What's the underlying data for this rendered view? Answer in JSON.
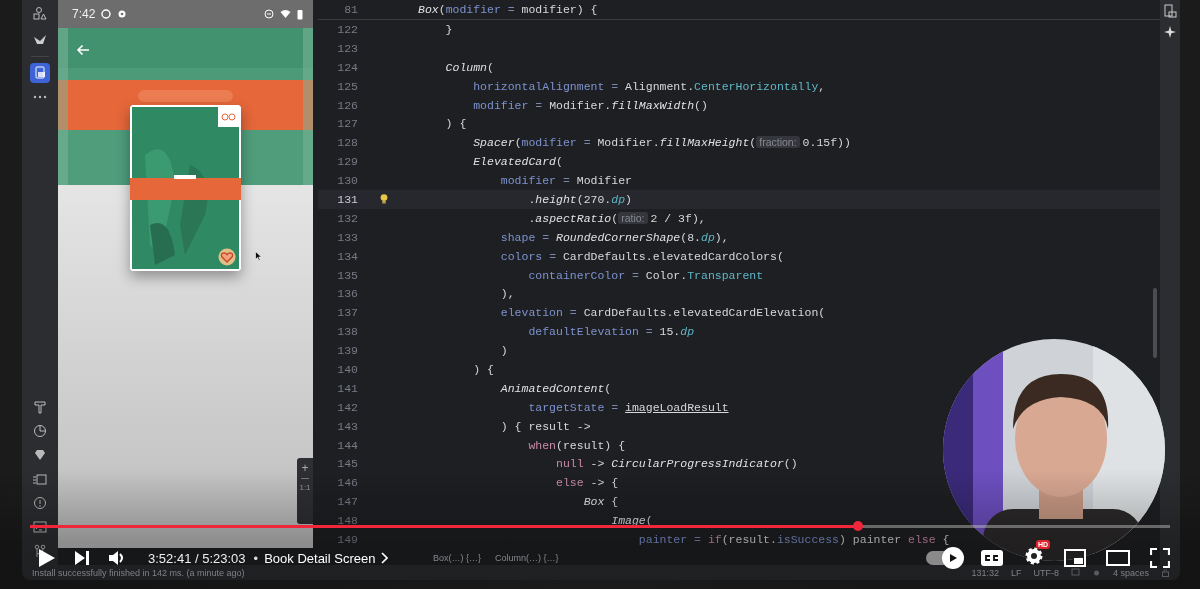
{
  "ide": {
    "tool_buttons_top": [
      {
        "selected": false
      },
      {
        "selected": false
      },
      {
        "selected": true
      }
    ],
    "emulator": {
      "status_bar": {
        "time": "7:42"
      },
      "zoom_controls": [
        "+",
        "1:1"
      ]
    },
    "editor": {
      "sticky_line": {
        "number": "81",
        "tokens": [
          {
            "kind": "italic",
            "text": "Box"
          },
          {
            "kind": "plain",
            "text": "("
          },
          {
            "kind": "param",
            "text": "modifier"
          },
          {
            "kind": "op",
            "text": " = "
          },
          {
            "kind": "plain",
            "text": "modifier) {"
          }
        ]
      },
      "lines": [
        {
          "number": "122",
          "current": false,
          "tokens": [
            {
              "kind": "plain",
              "text": "    }"
            }
          ]
        },
        {
          "number": "123",
          "current": false
        },
        {
          "number": "124",
          "current": false,
          "tokens": [
            {
              "kind": "italic",
              "text": "    Column"
            },
            {
              "kind": "plain",
              "text": "("
            }
          ]
        },
        {
          "number": "125",
          "current": false,
          "tokens": [
            {
              "kind": "param",
              "text": "        horizontalAlignment"
            },
            {
              "kind": "op",
              "text": " = "
            },
            {
              "kind": "plain",
              "text": "Alignment."
            },
            {
              "kind": "const",
              "text": "CenterHorizontally"
            },
            {
              "kind": "plain",
              "text": ","
            }
          ]
        },
        {
          "number": "126",
          "current": false,
          "tokens": [
            {
              "kind": "param",
              "text": "        modifier"
            },
            {
              "kind": "op",
              "text": " = "
            },
            {
              "kind": "plain",
              "text": "Modifier."
            },
            {
              "kind": "italic",
              "text": "fillMaxWidth"
            },
            {
              "kind": "plain",
              "text": "()"
            }
          ]
        },
        {
          "number": "127",
          "current": false,
          "tokens": [
            {
              "kind": "plain",
              "text": "    ) {"
            }
          ]
        },
        {
          "number": "128",
          "current": false,
          "tokens": [
            {
              "kind": "italic",
              "text": "        Spacer"
            },
            {
              "kind": "plain",
              "text": "("
            },
            {
              "kind": "param",
              "text": "modifier"
            },
            {
              "kind": "op",
              "text": " = "
            },
            {
              "kind": "plain",
              "text": "Modifier."
            },
            {
              "kind": "italic",
              "text": "fillMaxHeight"
            },
            {
              "kind": "plain",
              "text": "("
            },
            {
              "kind": "hint",
              "text": "fraction:"
            },
            {
              "kind": "plain",
              "text": "0.15f))"
            }
          ]
        },
        {
          "number": "129",
          "current": false,
          "tokens": [
            {
              "kind": "italic",
              "text": "        ElevatedCard"
            },
            {
              "kind": "plain",
              "text": "("
            }
          ]
        },
        {
          "number": "130",
          "current": false,
          "tokens": [
            {
              "kind": "param",
              "text": "            modifier"
            },
            {
              "kind": "op",
              "text": " = "
            },
            {
              "kind": "plain",
              "text": "Modifier"
            }
          ]
        },
        {
          "number": "131",
          "current": true,
          "tokens": [
            {
              "kind": "plain",
              "text": "                ."
            },
            {
              "kind": "italic",
              "text": "height"
            },
            {
              "kind": "plain",
              "text": "(270."
            },
            {
              "kind": "unit",
              "text": "dp"
            },
            {
              "kind": "plain",
              "text": ")"
            }
          ]
        },
        {
          "number": "132",
          "current": false,
          "tokens": [
            {
              "kind": "plain",
              "text": "                ."
            },
            {
              "kind": "italic",
              "text": "aspectRatio"
            },
            {
              "kind": "plain",
              "text": "("
            },
            {
              "kind": "hint",
              "text": "ratio:"
            },
            {
              "kind": "plain",
              "text": "2 / 3f),"
            }
          ]
        },
        {
          "number": "133",
          "current": false,
          "tokens": [
            {
              "kind": "param",
              "text": "            shape"
            },
            {
              "kind": "op",
              "text": " = "
            },
            {
              "kind": "italic",
              "text": "RoundedCornerShape"
            },
            {
              "kind": "plain",
              "text": "(8."
            },
            {
              "kind": "unit",
              "text": "dp"
            },
            {
              "kind": "plain",
              "text": "),"
            }
          ]
        },
        {
          "number": "134",
          "current": false,
          "tokens": [
            {
              "kind": "param",
              "text": "            colors"
            },
            {
              "kind": "op",
              "text": " = "
            },
            {
              "kind": "plain",
              "text": "CardDefaults.elevatedCardColors("
            }
          ]
        },
        {
          "number": "135",
          "current": false,
          "tokens": [
            {
              "kind": "param",
              "text": "                containerColor"
            },
            {
              "kind": "op",
              "text": " = "
            },
            {
              "kind": "plain",
              "text": "Color."
            },
            {
              "kind": "const",
              "text": "Transparent"
            }
          ]
        },
        {
          "number": "136",
          "current": false,
          "tokens": [
            {
              "kind": "plain",
              "text": "            ),"
            }
          ]
        },
        {
          "number": "137",
          "current": false,
          "tokens": [
            {
              "kind": "param",
              "text": "            elevation"
            },
            {
              "kind": "op",
              "text": " = "
            },
            {
              "kind": "plain",
              "text": "CardDefaults.elevatedCardElevation("
            }
          ]
        },
        {
          "number": "138",
          "current": false,
          "tokens": [
            {
              "kind": "param",
              "text": "                defaultElevation"
            },
            {
              "kind": "op",
              "text": " = "
            },
            {
              "kind": "plain",
              "text": "15."
            },
            {
              "kind": "unit",
              "text": "dp"
            }
          ]
        },
        {
          "number": "139",
          "current": false,
          "tokens": [
            {
              "kind": "plain",
              "text": "            )"
            }
          ]
        },
        {
          "number": "140",
          "current": false,
          "tokens": [
            {
              "kind": "plain",
              "text": "        ) {"
            }
          ]
        },
        {
          "number": "141",
          "current": false,
          "tokens": [
            {
              "kind": "italic",
              "text": "            AnimatedContent"
            },
            {
              "kind": "plain",
              "text": "("
            }
          ]
        },
        {
          "number": "142",
          "current": false,
          "tokens": [
            {
              "kind": "param",
              "text": "                targetState"
            },
            {
              "kind": "op",
              "text": " = "
            },
            {
              "kind": "link",
              "text": "imageLoadResult"
            }
          ]
        },
        {
          "number": "143",
          "current": false,
          "tokens": [
            {
              "kind": "plain",
              "text": "            ) { result ->"
            }
          ]
        },
        {
          "number": "144",
          "current": false,
          "tokens": [
            {
              "kind": "keyword",
              "text": "                when"
            },
            {
              "kind": "plain",
              "text": "(result) {"
            }
          ]
        },
        {
          "number": "145",
          "current": false,
          "tokens": [
            {
              "kind": "keyword",
              "text": "                    null"
            },
            {
              "kind": "plain",
              "text": " -> "
            },
            {
              "kind": "italic",
              "text": "CircularProgressIndicator"
            },
            {
              "kind": "plain",
              "text": "()"
            }
          ]
        },
        {
          "number": "146",
          "current": false,
          "tokens": [
            {
              "kind": "keyword",
              "text": "                    else"
            },
            {
              "kind": "plain",
              "text": " -> {"
            }
          ]
        },
        {
          "number": "147",
          "current": false,
          "tokens": [
            {
              "kind": "italic",
              "text": "                        Box"
            },
            {
              "kind": "plain",
              "text": " {"
            }
          ]
        },
        {
          "number": "148",
          "current": false,
          "tokens": [
            {
              "kind": "italic",
              "text": "                            Image"
            },
            {
              "kind": "plain",
              "text": "("
            }
          ]
        },
        {
          "number": "149",
          "current": false,
          "tokens": [
            {
              "kind": "param",
              "text": "                                painter"
            },
            {
              "kind": "op",
              "text": " = "
            },
            {
              "kind": "keyword",
              "text": "if"
            },
            {
              "kind": "plain",
              "text": "(result."
            },
            {
              "kind": "param",
              "text": "isSuccess"
            },
            {
              "kind": "plain",
              "text": ") painter "
            },
            {
              "kind": "keyword",
              "text": "else"
            },
            {
              "kind": "plain",
              "text": " {"
            }
          ]
        }
      ],
      "breadcrumbs": [
        "Box(…) {…}",
        "Column(…) {…}"
      ]
    },
    "status_bar": {
      "message": "Install successfully finished in 142 ms. (a minute ago)",
      "items": [
        "131:32",
        "LF",
        "UTF-8",
        "4 spaces"
      ]
    }
  },
  "video_player": {
    "progress": {
      "level": 0.726
    },
    "time": "3:52:41 / 5:23:03",
    "separator": "•",
    "chapter": "Book Detail Screen",
    "autoplay": true,
    "quality_badge": "HD"
  }
}
